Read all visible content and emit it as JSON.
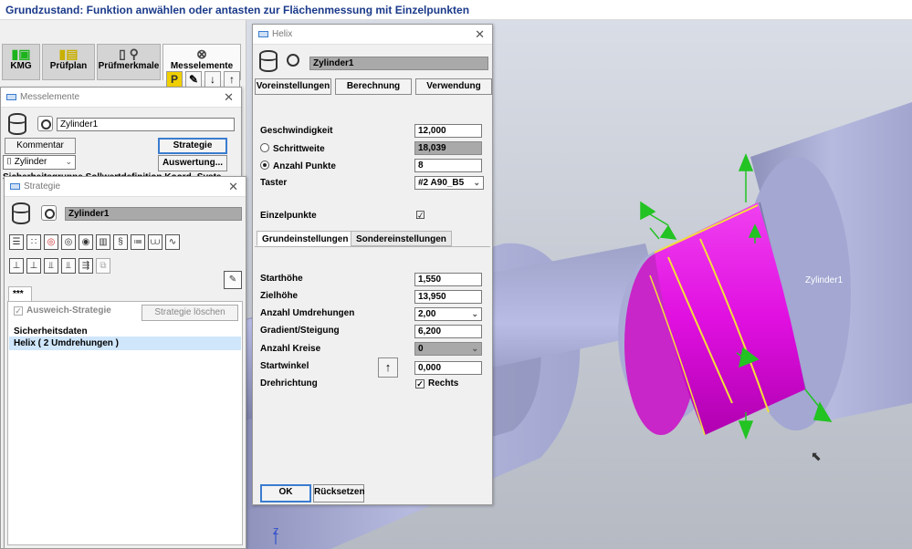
{
  "top_title": "Grundzustand: Funktion anwählen oder antasten zur Flächenmessung mit Einzelpunkten",
  "main_tabs": [
    {
      "label": "KMG",
      "icon": "cmm-icon"
    },
    {
      "label": "Prüfplan",
      "icon": "inspection-plan-icon"
    },
    {
      "label": "Prüfmerkmale",
      "icon": "characteristics-icon"
    },
    {
      "label": "Messelemente",
      "icon": "measuring-elements-icon"
    }
  ],
  "toolbar_icons": [
    "p-icon",
    "pencil-icon",
    "arrow-down-icon",
    "arrow-up-icon"
  ],
  "toolbar_p": "P",
  "messelemente": {
    "title": "Messelemente",
    "element_name": "Zylinder1",
    "kommentar_label": "Kommentar",
    "strategie_label": "Strategie",
    "type_select": "Zylinder",
    "auswertung_label": "Auswertung...",
    "cutoff_text": "Sicherheitsgruppe  Sollwertdefinition  Koord.-System"
  },
  "strategie": {
    "title": "Strategie",
    "element_name": "Zylinder1",
    "tab_label": "***",
    "ausweich_label": "Ausweich-Strategie",
    "loeschen_label": "Strategie löschen",
    "list_items": [
      "Sicherheitsdaten",
      "Helix  ( 2 Umdrehungen )"
    ],
    "selected_index": 1
  },
  "helix": {
    "title": "Helix",
    "element_name": "Zylinder1",
    "tabs": [
      "Voreinstellungen",
      "Berechnung",
      "Verwendung"
    ],
    "geschwindigkeit_label": "Geschwindigkeit",
    "geschwindigkeit_value": "12,000",
    "schrittweite_label": "Schrittweite",
    "schrittweite_value": "18,039",
    "anzahl_punkte_label": "Anzahl Punkte",
    "anzahl_punkte_value": "8",
    "taster_label": "Taster",
    "taster_value": "#2    A90_B5",
    "einzelpunkte_label": "Einzelpunkte",
    "einzelpunkte_checked": "☑",
    "subtabs": [
      "Grundeinstellungen",
      "Sondereinstellungen"
    ],
    "starthoehe_label": "Starthöhe",
    "starthoehe_value": "1,550",
    "zielhoehe_label": "Zielhöhe",
    "zielhoehe_value": "13,950",
    "umdrehungen_label": "Anzahl Umdrehungen",
    "umdrehungen_value": "2,00",
    "gradient_label": "Gradient/Steigung",
    "gradient_value": "6,200",
    "kreise_label": "Anzahl Kreise",
    "kreise_value": "0",
    "startwinkel_label": "Startwinkel",
    "startwinkel_value": "0,000",
    "drehrichtung_label": "Drehrichtung",
    "rechts_label": "Rechts",
    "ok_label": "OK",
    "ruecksetzen_label": "Rücksetzen"
  },
  "viewport": {
    "cylinder_label": "Zylinder1",
    "axis_label": "Z",
    "colors": {
      "part": "#a8acd8",
      "highlight": "#e010e0",
      "helix": "#f3e03a",
      "arrow": "#22c322"
    }
  }
}
